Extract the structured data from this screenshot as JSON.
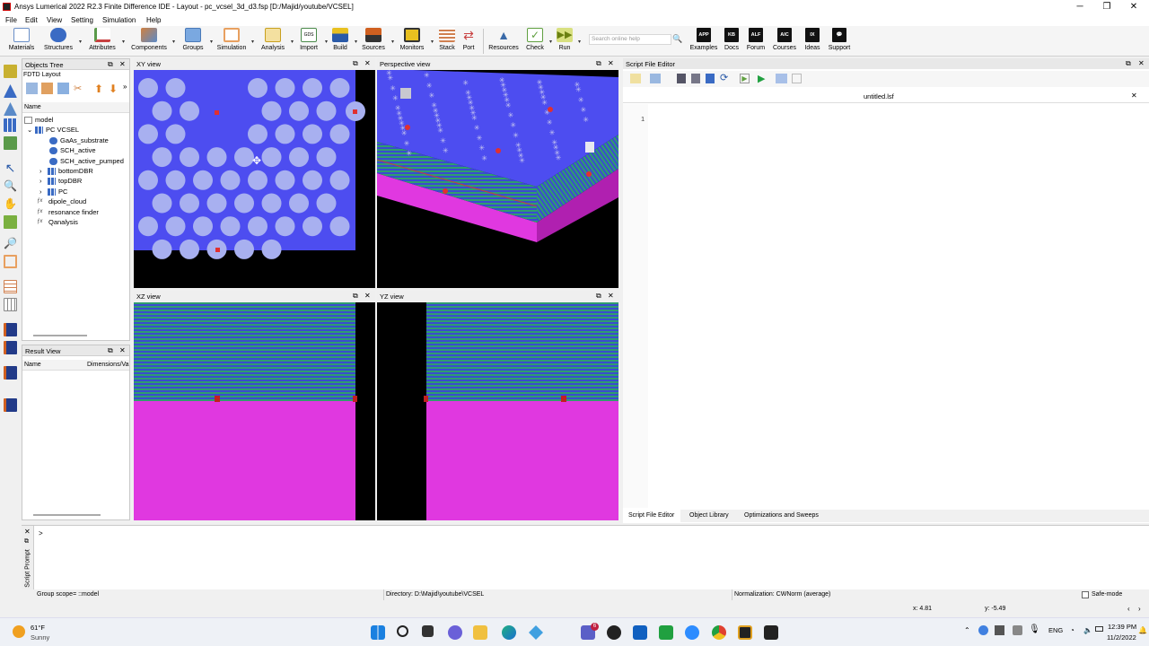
{
  "window": {
    "title": "Ansys Lumerical 2022 R2.3 Finite Difference IDE - Layout - pc_vcsel_3d_d3.fsp [D:/Majid/youtube/VCSEL]",
    "controls": [
      "─",
      "❐",
      "✕"
    ]
  },
  "menu": [
    "File",
    "Edit",
    "View",
    "Setting",
    "Simulation",
    "Help"
  ],
  "toolbar": {
    "items": [
      {
        "label": "Materials",
        "icon": "materials-icon",
        "color": "#6a8fc8"
      },
      {
        "label": "Structures",
        "icon": "structures-icon",
        "color": "#3a6bc4"
      },
      {
        "label": "Attributes",
        "icon": "attributes-icon",
        "color": "#5a9a4a"
      },
      {
        "label": "Components",
        "icon": "components-icon",
        "color": "#d08040"
      },
      {
        "label": "Groups",
        "icon": "groups-icon",
        "color": "#4a7ab8"
      },
      {
        "label": "Simulation",
        "icon": "simulation-icon",
        "color": "#e8a060"
      },
      {
        "label": "Analysis",
        "icon": "analysis-icon",
        "color": "#c8a020"
      },
      {
        "label": "Import",
        "icon": "import-icon",
        "color": "#4a8a4a"
      },
      {
        "label": "Build",
        "icon": "build-icon",
        "color": "#2a5aa8"
      },
      {
        "label": "Sources",
        "icon": "sources-icon",
        "color": "#d06020"
      },
      {
        "label": "Monitors",
        "icon": "monitors-icon",
        "color": "#e8c020"
      },
      {
        "label": "Stack",
        "icon": "stack-icon",
        "color": "#d08050"
      },
      {
        "label": "Port",
        "icon": "port-icon",
        "color": "#c84040"
      },
      {
        "label": "Resources",
        "icon": "resources-icon",
        "color": "#3a6aa8"
      },
      {
        "label": "Check",
        "icon": "check-icon",
        "color": "#60a040"
      },
      {
        "label": "Run",
        "icon": "run-icon",
        "color": "#a0b020"
      }
    ],
    "search_placeholder": "Search online help",
    "right_items": [
      {
        "label": "Examples",
        "badge": "APP"
      },
      {
        "label": "Docs",
        "badge": "KB"
      },
      {
        "label": "Forum",
        "badge": "ALF"
      },
      {
        "label": "Courses",
        "badge": "AIC"
      },
      {
        "label": "Ideas",
        "badge": "IX"
      },
      {
        "label": "Support",
        "badge": "💬"
      }
    ]
  },
  "objects_tree": {
    "title": "Objects Tree",
    "subtitle": "FDTD Layout",
    "column": "Name",
    "items": [
      {
        "label": "model",
        "indent": 0,
        "icon": "model-icon"
      },
      {
        "label": "PC VCSEL",
        "indent": 1,
        "icon": "group-icon",
        "expand": "⌄"
      },
      {
        "label": "GaAs_substrate",
        "indent": 2,
        "icon": "structure-icon"
      },
      {
        "label": "SCH_active",
        "indent": 2,
        "icon": "structure-icon"
      },
      {
        "label": "SCH_active_pumped",
        "indent": 2,
        "icon": "structure-icon"
      },
      {
        "label": "bottomDBR",
        "indent": 2,
        "icon": "group-icon",
        "expand": "›"
      },
      {
        "label": "topDBR",
        "indent": 2,
        "icon": "group-icon",
        "expand": "›"
      },
      {
        "label": "PC",
        "indent": 2,
        "icon": "group-icon",
        "expand": "›"
      },
      {
        "label": "dipole_cloud",
        "indent": 1,
        "icon": "script-icon"
      },
      {
        "label": "resonance finder",
        "indent": 1,
        "icon": "script-icon"
      },
      {
        "label": "Qanalysis",
        "indent": 1,
        "icon": "script-icon"
      }
    ]
  },
  "result_view": {
    "title": "Result View",
    "columns": [
      "Name",
      "Dimensions/Va"
    ]
  },
  "views": {
    "xy": "XY view",
    "perspective": "Perspective view",
    "xz": "XZ view",
    "yz": "YZ view"
  },
  "script_editor": {
    "title": "Script File Editor",
    "filename": "untitled.lsf",
    "line_number": "1"
  },
  "bottom_tabs": [
    "Script File Editor",
    "Object Library",
    "Optimizations and Sweeps"
  ],
  "script_prompt": {
    "label": "Script Prompt",
    "prompt_char": ">"
  },
  "status": {
    "group_scope": "Group scope= ::model",
    "directory": "Directory: D:\\Majid\\youtube\\VCSEL",
    "normalization": "Normalization: CWNorm (average)",
    "safe_mode": "Safe-mode",
    "x": "x: 4.81",
    "y": "y: -5.49"
  },
  "taskbar": {
    "weather_temp": "61°F",
    "weather_desc": "Sunny",
    "lang": "ENG",
    "time": "12:39 PM",
    "date": "11/2/2022",
    "badge": "6"
  },
  "colors": {
    "substrate_blue": "#4d4df0",
    "hole": "#a8b0f0",
    "dbr_green": "#2f9e6e",
    "dbr_blue": "#3a4bd0",
    "magenta": "#e038e0",
    "monitor_red": "#d02020"
  }
}
